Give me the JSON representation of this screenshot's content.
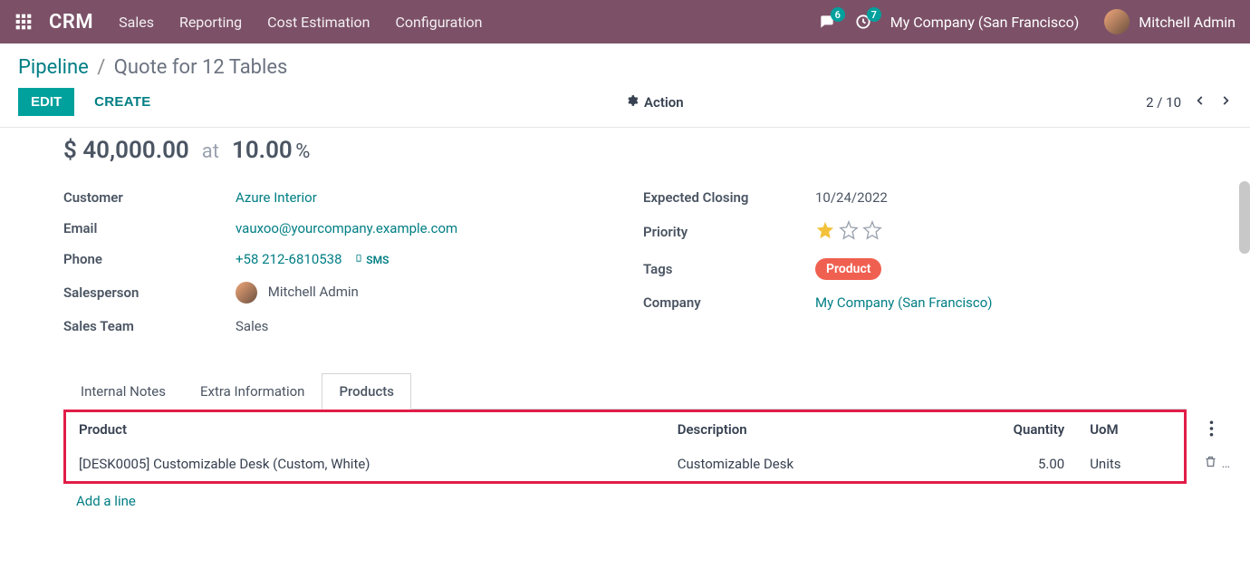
{
  "header": {
    "brand": "CRM",
    "nav": [
      "Sales",
      "Reporting",
      "Cost Estimation",
      "Configuration"
    ],
    "messages_count": "6",
    "activities_count": "7",
    "company": "My Company (San Francisco)",
    "user": "Mitchell Admin"
  },
  "breadcrumb": {
    "parent": "Pipeline",
    "current": "Quote for 12 Tables"
  },
  "controls": {
    "edit": "EDIT",
    "create": "CREATE",
    "action": "Action",
    "pager": "2 / 10"
  },
  "revenue": {
    "amount": "$ 40,000.00",
    "at_label": "at",
    "percentage": "10.00",
    "pct_unit": "%"
  },
  "left_fields": {
    "customer_label": "Customer",
    "customer_value": "Azure Interior",
    "email_label": "Email",
    "email_value": "vauxoo@yourcompany.example.com",
    "phone_label": "Phone",
    "phone_value": "+58 212-6810538",
    "sms_label": "SMS",
    "salesperson_label": "Salesperson",
    "salesperson_value": "Mitchell Admin",
    "salesteam_label": "Sales Team",
    "salesteam_value": "Sales"
  },
  "right_fields": {
    "closing_label": "Expected Closing",
    "closing_value": "10/24/2022",
    "priority_label": "Priority",
    "priority_stars": 1,
    "tags_label": "Tags",
    "tag_value": "Product",
    "company_label": "Company",
    "company_value": "My Company (San Francisco)"
  },
  "tabs": {
    "internal_notes": "Internal Notes",
    "extra_info": "Extra Information",
    "products": "Products"
  },
  "table": {
    "headers": {
      "product": "Product",
      "description": "Description",
      "quantity": "Quantity",
      "uom": "UoM"
    },
    "row0": {
      "product": "[DESK0005] Customizable Desk (Custom, White)",
      "description": "Customizable Desk",
      "quantity": "5.00",
      "uom": "Units"
    },
    "add_line": "Add a line"
  }
}
